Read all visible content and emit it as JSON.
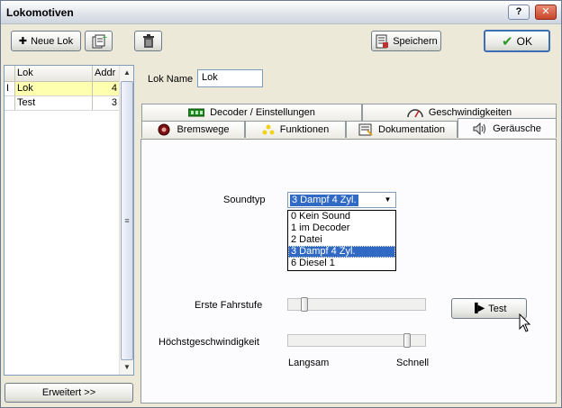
{
  "window": {
    "title": "Lokomotiven"
  },
  "titlebar_buttons": {
    "help": "?",
    "close": "✕"
  },
  "toolbar": {
    "new_loco": "Neue Lok",
    "save": "Speichern",
    "ok": "OK"
  },
  "list": {
    "headers": {
      "name": "Lok",
      "addr": "Addr"
    },
    "rows": [
      {
        "indicator": "I",
        "name": "Lok",
        "addr": "4"
      },
      {
        "indicator": "",
        "name": "Test",
        "addr": "3"
      }
    ],
    "selected_index": 0
  },
  "advanced_button": "Erweitert >>",
  "loco_name": {
    "label": "Lok Name",
    "value": "Lok"
  },
  "tabs": {
    "decoder": "Decoder / Einstellungen",
    "speed": "Geschwindigkeiten",
    "brake": "Bremswege",
    "functions": "Funktionen",
    "docs": "Dokumentation",
    "sounds": "Geräusche",
    "active": "sounds"
  },
  "sound": {
    "type_label": "Soundtyp",
    "selected": "3 Dampf 4 Zyl.",
    "options": [
      "0 Kein Sound",
      "1 im Decoder",
      "2 Datei",
      "3 Dampf 4 Zyl.",
      "6 Diesel 1"
    ],
    "first_step_label": "Erste Fahrstufe",
    "max_speed_label": "Höchstgeschwindigkeit",
    "slow_label": "Langsam",
    "fast_label": "Schnell",
    "test_button": "Test",
    "first_step_level": 0.1,
    "max_speed_level": 0.9
  },
  "colors": {
    "selection_blue": "#316ac5",
    "selected_row_yellow": "#ffffb0",
    "ok_border": "#3c6fb5"
  }
}
